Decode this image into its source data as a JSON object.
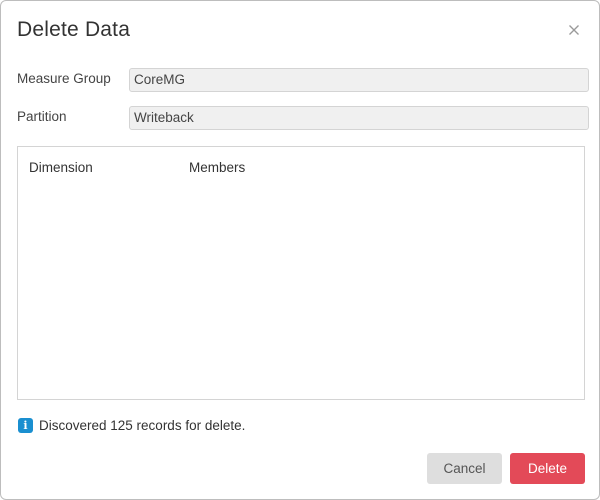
{
  "dialog": {
    "title": "Delete Data",
    "close_icon": "close-icon"
  },
  "form": {
    "measure_group": {
      "label": "Measure Group",
      "value": "CoreMG"
    },
    "partition": {
      "label": "Partition",
      "value": "Writeback"
    }
  },
  "grid": {
    "columns": [
      "Dimension",
      "Members"
    ],
    "rows": []
  },
  "info": {
    "icon": "info-icon",
    "icon_color": "#1a8fd0",
    "message": "Discovered 125 records for delete."
  },
  "buttons": {
    "cancel_label": "Cancel",
    "delete_label": "Delete",
    "delete_color": "#e34a58"
  }
}
